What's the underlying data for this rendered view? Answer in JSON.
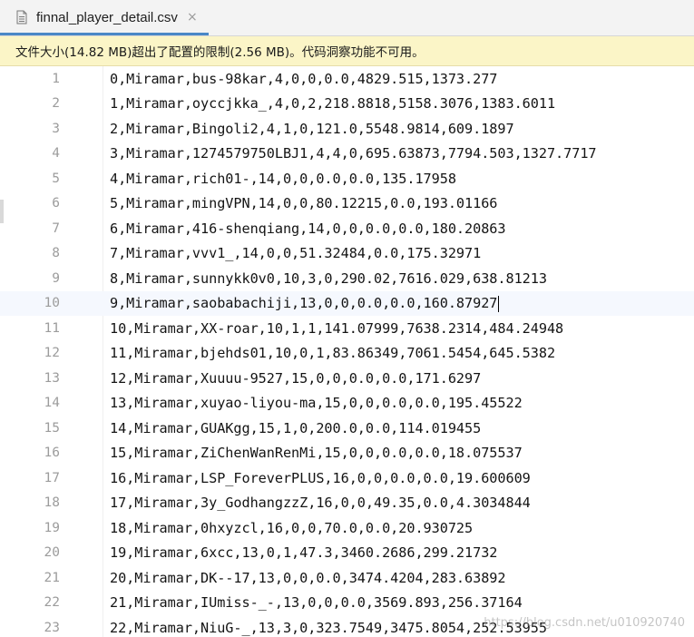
{
  "tab": {
    "title": "finnal_player_detail.csv",
    "close_glyph": "×"
  },
  "banner": {
    "message": "文件大小(14.82 MB)超出了配置的限制(2.56 MB)。代码洞察功能不可用。"
  },
  "editor": {
    "current_line": 10,
    "lines": [
      {
        "no": "1",
        "text": "0,Miramar,bus-98kar,4,0,0,0.0,4829.515,1373.277"
      },
      {
        "no": "2",
        "text": "1,Miramar,oyccjkka_,4,0,2,218.8818,5158.3076,1383.6011"
      },
      {
        "no": "3",
        "text": "2,Miramar,Bingoli2,4,1,0,121.0,5548.9814,609.1897"
      },
      {
        "no": "4",
        "text": "3,Miramar,1274579750LBJ1,4,4,0,695.63873,7794.503,1327.7717"
      },
      {
        "no": "5",
        "text": "4,Miramar,rich01-,14,0,0,0.0,0.0,135.17958"
      },
      {
        "no": "6",
        "text": "5,Miramar,mingVPN,14,0,0,80.12215,0.0,193.01166"
      },
      {
        "no": "7",
        "text": "6,Miramar,416-shenqiang,14,0,0,0.0,0.0,180.20863"
      },
      {
        "no": "8",
        "text": "7,Miramar,vvv1_,14,0,0,51.32484,0.0,175.32971"
      },
      {
        "no": "9",
        "text": "8,Miramar,sunnykk0v0,10,3,0,290.02,7616.029,638.81213"
      },
      {
        "no": "10",
        "text": "9,Miramar,saobabachiji,13,0,0,0.0,0.0,160.87927"
      },
      {
        "no": "11",
        "text": "10,Miramar,XX-roar,10,1,1,141.07999,7638.2314,484.24948"
      },
      {
        "no": "12",
        "text": "11,Miramar,bjehds01,10,0,1,83.86349,7061.5454,645.5382"
      },
      {
        "no": "13",
        "text": "12,Miramar,Xuuuu-9527,15,0,0,0.0,0.0,171.6297"
      },
      {
        "no": "14",
        "text": "13,Miramar,xuyao-liyou-ma,15,0,0,0.0,0.0,195.45522"
      },
      {
        "no": "15",
        "text": "14,Miramar,GUAKgg,15,1,0,200.0,0.0,114.019455"
      },
      {
        "no": "16",
        "text": "15,Miramar,ZiChenWanRenMi,15,0,0,0.0,0.0,18.075537"
      },
      {
        "no": "17",
        "text": "16,Miramar,LSP_ForeverPLUS,16,0,0,0.0,0.0,19.600609"
      },
      {
        "no": "18",
        "text": "17,Miramar,3y_GodhangzzZ,16,0,0,49.35,0.0,4.3034844"
      },
      {
        "no": "19",
        "text": "18,Miramar,0hxyzcl,16,0,0,70.0,0.0,20.930725"
      },
      {
        "no": "20",
        "text": "19,Miramar,6xcc,13,0,1,47.3,3460.2686,299.21732"
      },
      {
        "no": "21",
        "text": "20,Miramar,DK--17,13,0,0,0.0,3474.4204,283.63892"
      },
      {
        "no": "22",
        "text": "21,Miramar,IUmiss-_-,13,0,0,0.0,3569.893,256.37164"
      },
      {
        "no": "23",
        "text": "22,Miramar,NiuG-_,13,3,0,323.7549,3475.8054,252.53955"
      }
    ]
  },
  "watermark": {
    "text": "https://blog.csdn.net/u010920740"
  },
  "icons": {
    "file": "csv-file-icon",
    "close": "close-icon"
  },
  "colors": {
    "accent": "#4a88c7",
    "banner_bg": "#fbf5c7",
    "current_line_bg": "#f5f8fe"
  }
}
